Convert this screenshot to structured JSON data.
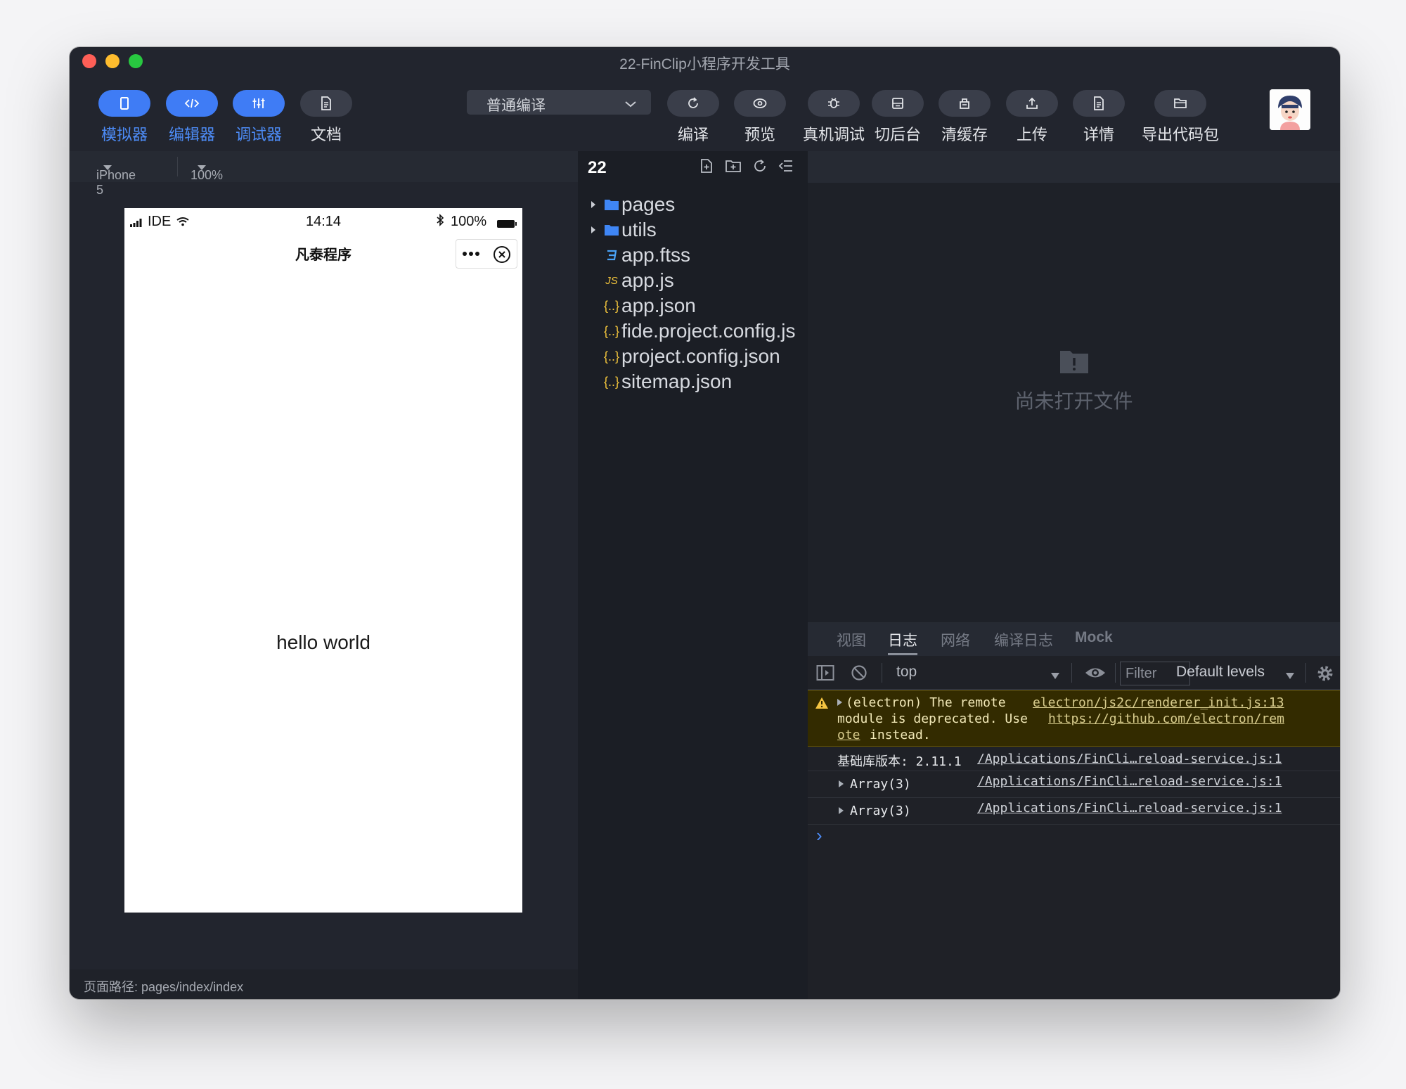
{
  "window": {
    "title": "22-FinClip小程序开发工具"
  },
  "toolbar": {
    "simulator": "模拟器",
    "editor": "编辑器",
    "debugger": "调试器",
    "docs": "文档",
    "compile_mode": "普通编译",
    "compile": "编译",
    "preview": "预览",
    "device_debug": "真机调试",
    "background": "切后台",
    "clear_cache": "清缓存",
    "upload": "上传",
    "details": "详情",
    "export": "导出代码包"
  },
  "simulator": {
    "device": "iPhone 5",
    "zoom": "100%",
    "status": {
      "carrier": "IDE",
      "time": "14:14",
      "battery": "100%"
    },
    "nav_title": "凡泰程序",
    "body_text": "hello world",
    "page_path": "页面路径: pages/index/index"
  },
  "explorer": {
    "project": "22",
    "files": [
      {
        "name": "pages",
        "type": "folder"
      },
      {
        "name": "utils",
        "type": "folder"
      },
      {
        "name": "app.ftss",
        "type": "ftss"
      },
      {
        "name": "app.js",
        "type": "js"
      },
      {
        "name": "app.json",
        "type": "json"
      },
      {
        "name": "fide.project.config.js",
        "type": "json"
      },
      {
        "name": "project.config.json",
        "type": "json"
      },
      {
        "name": "sitemap.json",
        "type": "json"
      }
    ]
  },
  "editor": {
    "empty_text": "尚未打开文件"
  },
  "devtools": {
    "tabs": [
      "视图",
      "日志",
      "网络",
      "编译日志",
      "Mock"
    ],
    "active_tab": "日志",
    "context": "top",
    "filter_placeholder": "Filter",
    "levels": "Default levels",
    "warning": {
      "line1": "(electron) The remote",
      "source": "electron/js2c/renderer_init.js:13",
      "line2": "module is deprecated. Use",
      "url1": "https://github.com/electron/rem",
      "url2": "ote",
      "tail": "instead."
    },
    "logs": [
      {
        "text": "基础库版本: 2.11.1",
        "source": "/Applications/FinCli…reload-service.js:1"
      },
      {
        "text": "Array(3)",
        "source": "/Applications/FinCli…reload-service.js:1"
      },
      {
        "text": "Array(3)",
        "source": "/Applications/FinCli…reload-service.js:1"
      }
    ],
    "prompt": "›"
  },
  "colors": {
    "accent": "#3f7cf5",
    "warning_bg": "#332b00",
    "window_bg": "#22252e"
  }
}
